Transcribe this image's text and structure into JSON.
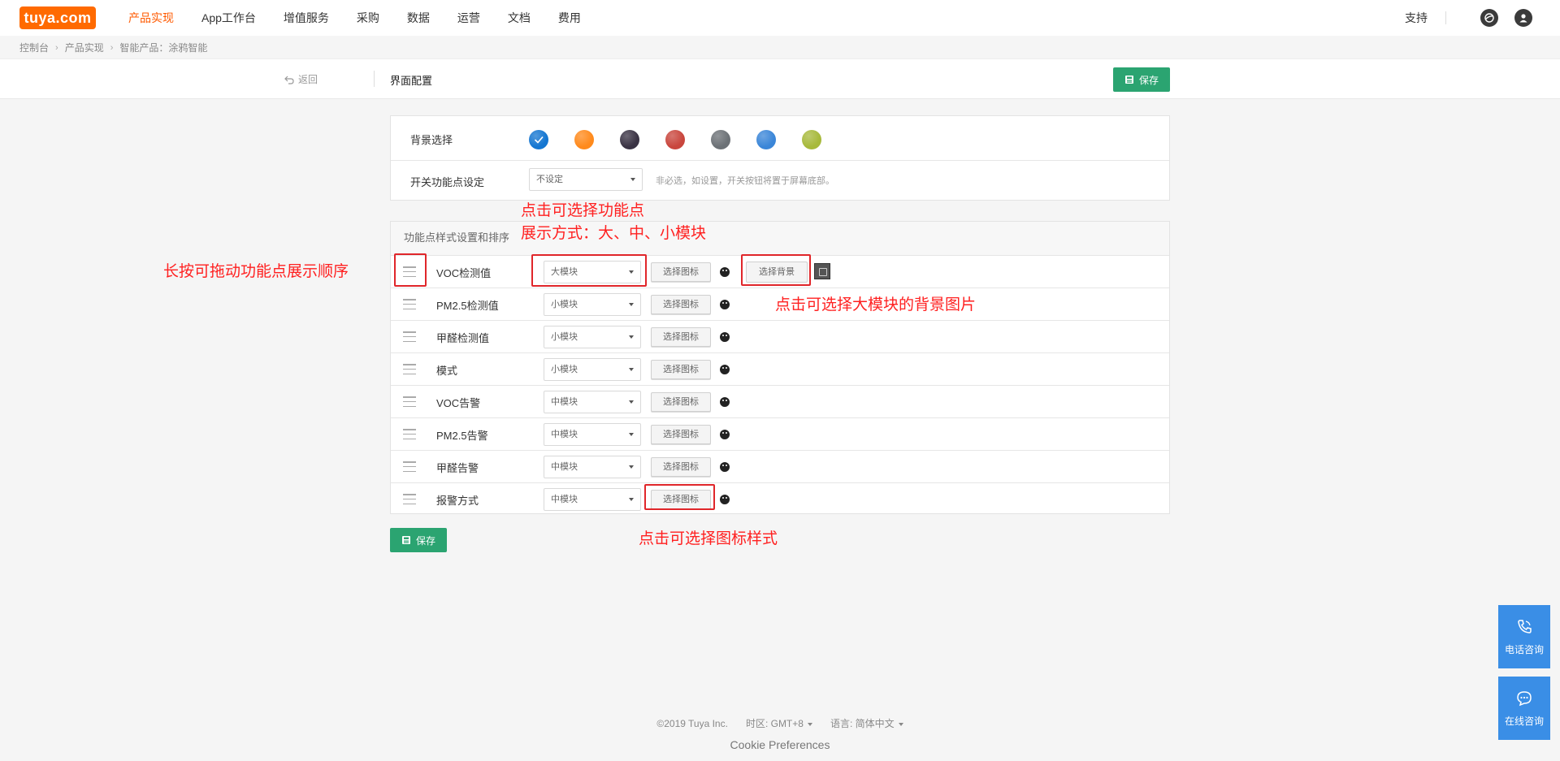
{
  "topnav": {
    "logo": "tuya.com",
    "items": [
      "产品实现",
      "App工作台",
      "增值服务",
      "采购",
      "数据",
      "运营",
      "文档",
      "费用"
    ],
    "active_index": 0,
    "support": "支持"
  },
  "breadcrumb": [
    "控制台",
    "产品实现",
    "智能产品：涂鸦智能"
  ],
  "subheader": {
    "back": "返回",
    "title": "界面配置",
    "save": "保存"
  },
  "background": {
    "label": "背景选择",
    "colors": [
      "#1476d1",
      "#ff8a1c",
      "#3a3344",
      "#c9463d",
      "#6c7176",
      "#3b86d8",
      "#a7b93b"
    ],
    "selected_index": 0
  },
  "switch_point": {
    "label": "开关功能点设定",
    "value": "不设定",
    "hint": "非必选，如设置，开关按钮将置于屏幕底部。"
  },
  "functions": {
    "header": "功能点样式设置和排序",
    "pick_icon_label": "选择图标",
    "pick_bg_label": "选择背景",
    "rows": [
      {
        "name": "VOC检测值",
        "size": "大模块"
      },
      {
        "name": "PM2.5检测值",
        "size": "小模块"
      },
      {
        "name": "甲醛检测值",
        "size": "小模块"
      },
      {
        "name": "模式",
        "size": "小模块"
      },
      {
        "name": "VOC告警",
        "size": "中模块"
      },
      {
        "name": "PM2.5告警",
        "size": "中模块"
      },
      {
        "name": "甲醛告警",
        "size": "中模块"
      },
      {
        "name": "报警方式",
        "size": "中模块"
      }
    ]
  },
  "bottom_save": "保存",
  "annotations": {
    "select_style_line1": "点击可选择功能点",
    "select_style_line2": "展示方式：大、中、小模块",
    "drag": "长按可拖动功能点展示顺序",
    "select_bg": "点击可选择大模块的背景图片",
    "select_icon": "点击可选择图标样式"
  },
  "footer": {
    "copyright": "©2019 Tuya Inc.",
    "timezone": "时区: GMT+8",
    "language": "语言: 简体中文",
    "cookie": "Cookie Preferences"
  },
  "float": {
    "phone": "电话咨询",
    "online": "在线咨询"
  }
}
